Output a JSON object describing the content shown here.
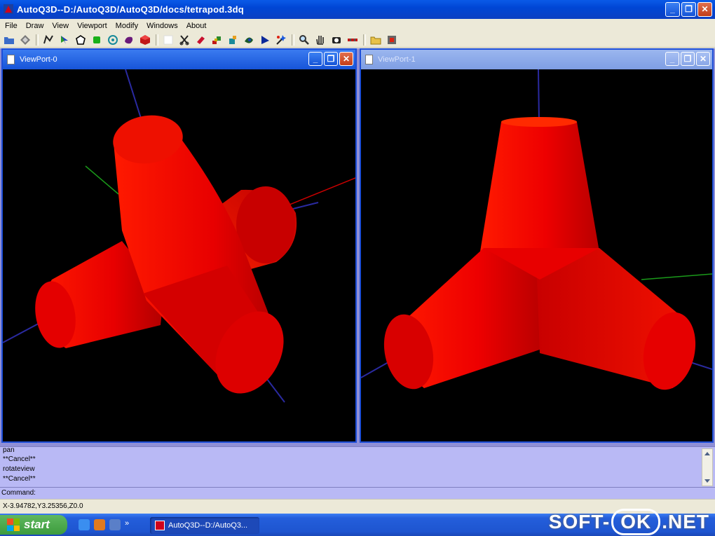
{
  "window": {
    "title": "AutoQ3D--D:/AutoQ3D/AutoQ3D/docs/tetrapod.3dq",
    "minimize": "_",
    "maximize": "❐",
    "close": "✕"
  },
  "menu": [
    "File",
    "Draw",
    "View",
    "Viewport",
    "Modify",
    "Windows",
    "About"
  ],
  "toolbar_icons": [
    "open-folder-icon",
    "save-icon",
    "polyline-icon",
    "arrow-icon",
    "pentagon-icon",
    "cube-icon",
    "circle-icon",
    "sphere-icon",
    "box-icon",
    "blank-icon",
    "scissors-icon",
    "eraser-icon",
    "stack-icon",
    "paint-icon",
    "surface-icon",
    "pointer-icon",
    "wand-icon",
    "zoom-icon",
    "hand-icon",
    "camera-icon",
    "measure-icon",
    "folder-icon",
    "render-icon"
  ],
  "viewports": [
    {
      "title": "ViewPort-0",
      "state": "active"
    },
    {
      "title": "ViewPort-1",
      "state": "inactive"
    }
  ],
  "console": {
    "lines": [
      "pan",
      "**Cancel**",
      "rotateview",
      "**Cancel**"
    ]
  },
  "command": {
    "label": "Command:",
    "value": ""
  },
  "status": {
    "coords": "X-3.94782,Y3.25356,Z0.0"
  },
  "taskbar": {
    "start": "start",
    "task_label": "AutoQ3D--D:/AutoQ3...",
    "quicklaunch_more": "»"
  },
  "watermark": {
    "left": "SOFT-",
    "mid": "OK",
    "right": ".NET"
  },
  "colors": {
    "object": "#ff0000",
    "background": "#000000",
    "console": "#b9b9f5"
  }
}
